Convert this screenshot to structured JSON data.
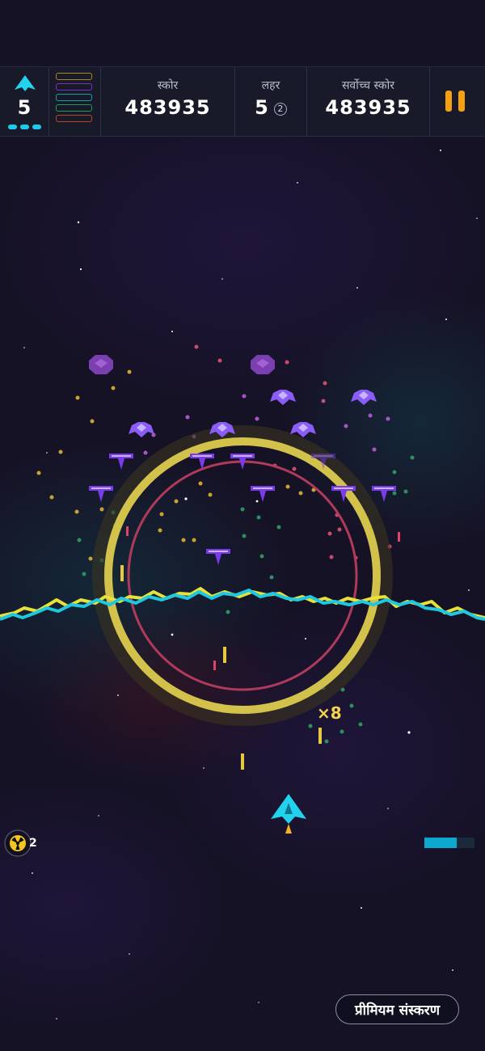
{
  "hud": {
    "lives": "5",
    "lives_dots": 3,
    "weapon_colors": [
      "#a68a1c",
      "#7a2fc4",
      "#1e9bb0",
      "#1f9b53",
      "#b5491f"
    ],
    "score_label": "स्कोर",
    "score_value": "483935",
    "wave_label": "लहर",
    "wave_value": "5",
    "wave_sub": "2",
    "high_label": "सर्वोच्च स्कोर",
    "high_value": "483935"
  },
  "game": {
    "multiplier": "×8",
    "nuke_count": "2",
    "shield_level": 0.65,
    "premium_label": "प्रीमियम संस्करण"
  },
  "colors": {
    "player": "#22d3ee",
    "enemy": "#8b5cf6",
    "ring_outer": "#d2c24b",
    "ring_inner": "#b03a5a",
    "accent": "#f5a10f"
  }
}
